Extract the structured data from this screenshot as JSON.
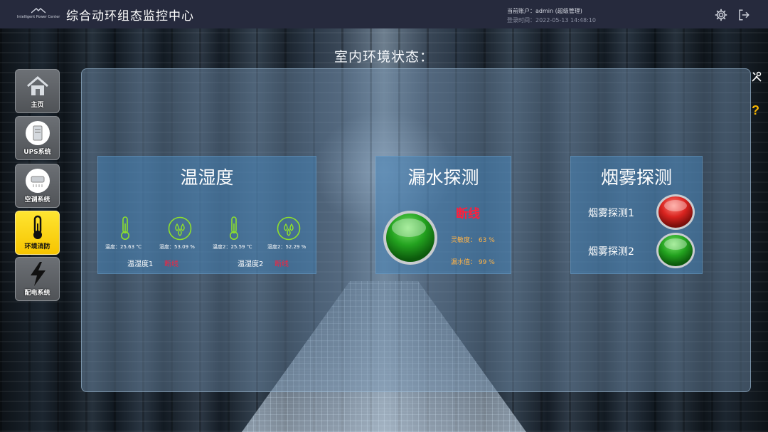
{
  "header": {
    "logo_text": "Intelligent Power Center",
    "title": "综合动环组态监控中心",
    "account_line": "当前账户：admin (超级管理)",
    "login_time": "登录时间：2022-05-13 14:48:10",
    "icons": [
      "gear-icon",
      "logout-icon"
    ]
  },
  "sidebar": {
    "items": [
      {
        "label": "主页",
        "icon": "home-icon",
        "active": false
      },
      {
        "label": "UPS系统",
        "icon": "ups-icon",
        "active": false
      },
      {
        "label": "空调系统",
        "icon": "air-conditioner-icon",
        "active": false
      },
      {
        "label": "环境消防",
        "icon": "thermometer-icon",
        "active": true
      },
      {
        "label": "配电系统",
        "icon": "lightning-icon",
        "active": false
      }
    ]
  },
  "main": {
    "section_title": "室内环境状态：",
    "temp_humidity": {
      "title": "温湿度",
      "sensors": [
        {
          "temp": "温度：25.63 ℃",
          "humidity": "湿度：53.09 %",
          "name": "温湿度1",
          "status": "断线"
        },
        {
          "temp": "温度2：25.59 ℃",
          "humidity": "湿度2：52.29 %",
          "name": "温湿度2",
          "status": "断线"
        }
      ]
    },
    "water_leak": {
      "title": "漏水探测",
      "status": "断线",
      "sensitivity_label": "灵敏度：",
      "sensitivity_value": "63 %",
      "leak_label": "漏水值：",
      "leak_value": "99 %",
      "indicator_color": "#1f9a1f"
    },
    "smoke": {
      "title": "烟雾探测",
      "detectors": [
        {
          "label": "烟雾探测1",
          "state_color": "#d9231f"
        },
        {
          "label": "烟雾探测2",
          "state_color": "#1f9a1f"
        }
      ]
    }
  },
  "right_tools": {
    "tools_icon": "tools-icon",
    "help": "?"
  },
  "colors": {
    "header_bg": "#262a3d",
    "active_nav": "#f6c400",
    "alarm": "#ff1f3c",
    "orange_text": "#ffb347"
  }
}
